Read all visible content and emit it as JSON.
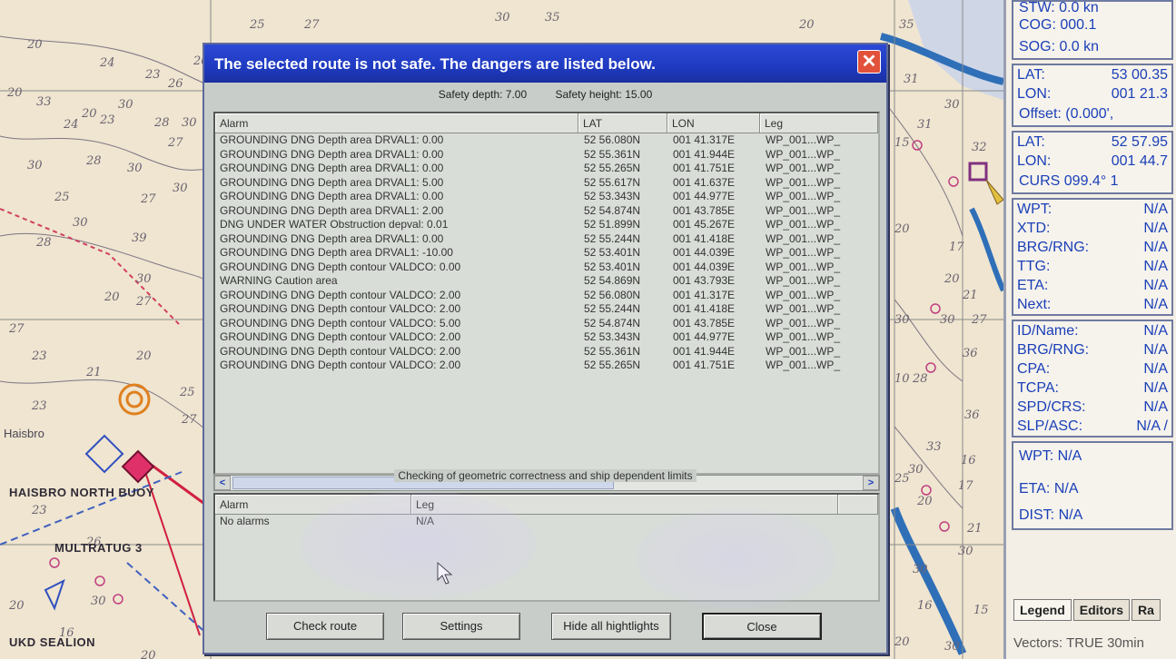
{
  "chart": {
    "depth_soundings": [
      "20",
      "24",
      "23",
      "26",
      "26",
      "25",
      "20",
      "27",
      "30",
      "35",
      "20",
      "33",
      "20",
      "30",
      "24",
      "23",
      "28",
      "30",
      "27",
      "30",
      "28",
      "30",
      "25",
      "30",
      "27",
      "30",
      "39",
      "28",
      "30",
      "20",
      "27",
      "27",
      "23",
      "20",
      "21",
      "23",
      "25",
      "27",
      "23",
      "26",
      "20",
      "30",
      "16",
      "20",
      "31",
      "15",
      "30",
      "32",
      "31",
      "17",
      "30",
      "30",
      "36",
      "10",
      "28",
      "21",
      "20",
      "36",
      "17",
      "20",
      "30",
      "21",
      "16",
      "33",
      "30",
      "20",
      "25",
      "30",
      "15",
      "20",
      "27",
      "35",
      "30",
      "16"
    ],
    "labels": {
      "buoy1": "HAISBRO NORTH BUOY",
      "buoy2": "MULTRATUG 3",
      "buoy3": "UKD SEALION",
      "place": "Haisbro"
    }
  },
  "info_panel": {
    "stw": "STW: 0.0 kn",
    "cog": "COG: 000.1",
    "sog": "SOG: 0.0 kn",
    "lat1_label": "LAT:",
    "lat1_value": "53 00.35",
    "lon1_label": "LON:",
    "lon1_value": "001 21.3",
    "offset": "Offset: (0.000',",
    "lat2_label": "LAT:",
    "lat2_value": "52 57.95",
    "lon2_label": "LON:",
    "lon2_value": "001 44.7",
    "curs": "CURS 099.4°  1",
    "wpt_label": "WPT:",
    "wpt_value": "N/A",
    "xtd_label": "XTD:",
    "xtd_value": "N/A",
    "brgrng_label": "BRG/RNG:",
    "brgrng_value": "N/A",
    "ttg_label": "TTG:",
    "ttg_value": "N/A",
    "eta_label": "ETA:",
    "eta_value": "N/A",
    "next_label": "Next:",
    "next_value": "N/A",
    "idname_label": "ID/Name:",
    "idname_value": "N/A",
    "brgrng2_label": "BRG/RNG:",
    "brgrng2_value": "N/A",
    "cpa_label": "CPA:",
    "cpa_value": "N/A",
    "tcpa_label": "TCPA:",
    "tcpa_value": "N/A",
    "spdcrs_label": "SPD/CRS:",
    "spdcrs_value": "N/A",
    "slpasc_label": "SLP/ASC:",
    "slpasc_value": "N/A /",
    "wpt2": "WPT: N/A",
    "eta2": "ETA: N/A",
    "dist": "DIST: N/A",
    "tabs": [
      "Legend",
      "Editors",
      "Ra"
    ],
    "vectors": "Vectors: TRUE  30min"
  },
  "dialog": {
    "title": "The selected route is not safe. The dangers are listed below.",
    "close_glyph": "✕",
    "safety_depth": "Safety depth: 7.00",
    "safety_height": "Safety height: 15.00",
    "table": {
      "headers": [
        "Alarm",
        "LAT",
        "LON",
        "Leg"
      ],
      "rows": [
        [
          "GROUNDING DNG Depth area DRVAL1: 0.00",
          "52 56.080N",
          "001 41.317E",
          "WP_001...WP_"
        ],
        [
          "GROUNDING DNG Depth area DRVAL1: 0.00",
          "52 55.361N",
          "001 41.944E",
          "WP_001...WP_"
        ],
        [
          "GROUNDING DNG Depth area DRVAL1: 0.00",
          "52 55.265N",
          "001 41.751E",
          "WP_001...WP_"
        ],
        [
          "GROUNDING DNG Depth area DRVAL1: 5.00",
          "52 55.617N",
          "001 41.637E",
          "WP_001...WP_"
        ],
        [
          "GROUNDING DNG Depth area DRVAL1: 0.00",
          "52 53.343N",
          "001 44.977E",
          "WP_001...WP_"
        ],
        [
          "GROUNDING DNG Depth area DRVAL1: 2.00",
          "52 54.874N",
          "001 43.785E",
          "WP_001...WP_"
        ],
        [
          "DNG UNDER WATER Obstruction depval: 0.01",
          "52 51.899N",
          "001 45.267E",
          "WP_001...WP_"
        ],
        [
          "GROUNDING DNG Depth area DRVAL1: 0.00",
          "52 55.244N",
          "001 41.418E",
          "WP_001...WP_"
        ],
        [
          "GROUNDING DNG Depth area DRVAL1: -10.00",
          "52 53.401N",
          "001 44.039E",
          "WP_001...WP_"
        ],
        [
          "GROUNDING DNG Depth contour VALDCO: 0.00",
          "52 53.401N",
          "001 44.039E",
          "WP_001...WP_"
        ],
        [
          "WARNING Caution area",
          "52 54.869N",
          "001 43.793E",
          "WP_001...WP_"
        ],
        [
          "GROUNDING DNG Depth contour VALDCO: 2.00",
          "52 56.080N",
          "001 41.317E",
          "WP_001...WP_"
        ],
        [
          "GROUNDING DNG Depth contour VALDCO: 2.00",
          "52 55.244N",
          "001 41.418E",
          "WP_001...WP_"
        ],
        [
          "GROUNDING DNG Depth contour VALDCO: 5.00",
          "52 54.874N",
          "001 43.785E",
          "WP_001...WP_"
        ],
        [
          "GROUNDING DNG Depth contour VALDCO: 2.00",
          "52 53.343N",
          "001 44.977E",
          "WP_001...WP_"
        ],
        [
          "GROUNDING DNG Depth contour VALDCO: 2.00",
          "52 55.361N",
          "001 41.944E",
          "WP_001...WP_"
        ],
        [
          "GROUNDING DNG Depth contour VALDCO: 2.00",
          "52 55.265N",
          "001 41.751E",
          "WP_001...WP_"
        ]
      ]
    },
    "scroll_left": "<",
    "scroll_right": ">",
    "geom_caption": "Checking of geometric correctness and ship dependent limits",
    "geom_table": {
      "headers": [
        "Alarm",
        "Leg",
        ""
      ],
      "rows": [
        [
          "No alarms",
          "N/A",
          ""
        ]
      ]
    },
    "buttons": {
      "check_route": "Check route",
      "settings": "Settings",
      "hide_highlights": "Hide all hightlights",
      "close": "Close"
    }
  }
}
